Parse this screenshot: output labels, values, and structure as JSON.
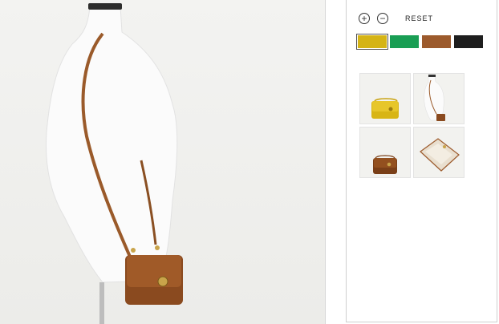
{
  "product_viewer": {
    "zoom_in_symbol": "+",
    "zoom_out_symbol": "−",
    "reset_label": "RESET",
    "swatches": [
      {
        "color": "#d5b416",
        "selected": true
      },
      {
        "color": "#199e54",
        "selected": false
      },
      {
        "color": "#9c5a2c",
        "selected": false
      },
      {
        "color": "#1e1e1e",
        "selected": false
      }
    ],
    "thumbnails": [
      {
        "subject": "yellow-bag-front"
      },
      {
        "subject": "mannequin-wearing-bag"
      },
      {
        "subject": "brown-bag-front"
      },
      {
        "subject": "bag-open-interior"
      }
    ]
  },
  "icons": {
    "zoom_in": "plus-circle-icon",
    "zoom_out": "minus-circle-icon"
  }
}
